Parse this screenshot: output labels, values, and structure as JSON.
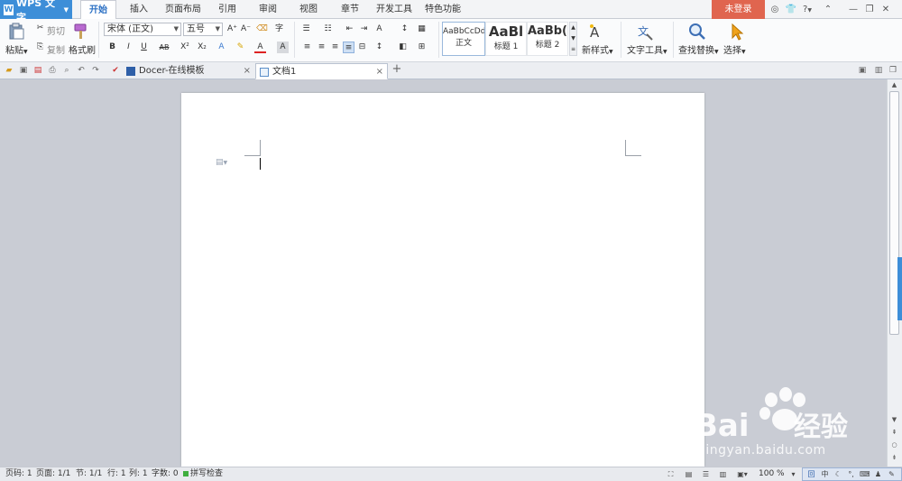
{
  "app": {
    "name": "WPS 文字"
  },
  "menu": {
    "tabs": [
      {
        "label": "开始"
      },
      {
        "label": "插入"
      },
      {
        "label": "页面布局"
      },
      {
        "label": "引用"
      },
      {
        "label": "审阅"
      },
      {
        "label": "视图"
      },
      {
        "label": "章节"
      },
      {
        "label": "开发工具"
      },
      {
        "label": "特色功能"
      }
    ],
    "login": "未登录",
    "help": "?"
  },
  "ribbon": {
    "paste": "粘贴",
    "cut": "剪切",
    "copy": "复制",
    "format_painter": "格式刷",
    "font_name": "宋体 (正文)",
    "font_size": "五号",
    "bold": "B",
    "italic": "I",
    "underline": "U",
    "strike": "AB",
    "superscript": "X²",
    "subscript": "X₂",
    "styles": [
      {
        "sample": "AaBbCcDd",
        "name": "正文"
      },
      {
        "sample": "AaBl",
        "name": "标题 1"
      },
      {
        "sample": "AaBb(",
        "name": "标题 2"
      }
    ],
    "new_style": "新样式",
    "text_tools": "文字工具",
    "find_replace": "查找替换",
    "select": "选择"
  },
  "doc_tabs": [
    {
      "label": "Docer-在线模板"
    },
    {
      "label": "文档1"
    }
  ],
  "status": {
    "page": "页码: 1",
    "pages": "页面: 1/1",
    "section": "节: 1/1",
    "line": "行: 1",
    "col": "列: 1",
    "words": "字数: 0",
    "spell": "拼写检查",
    "zoom": "100 %"
  },
  "ime": {
    "lang": "中"
  },
  "watermark": {
    "text": "jingyan.baidu.com",
    "brand": "Bai",
    "brand2": "经验"
  },
  "colors": {
    "accent": "#3d8ed8",
    "login": "#e0654f",
    "active_tab_text": "#2b70c4"
  }
}
